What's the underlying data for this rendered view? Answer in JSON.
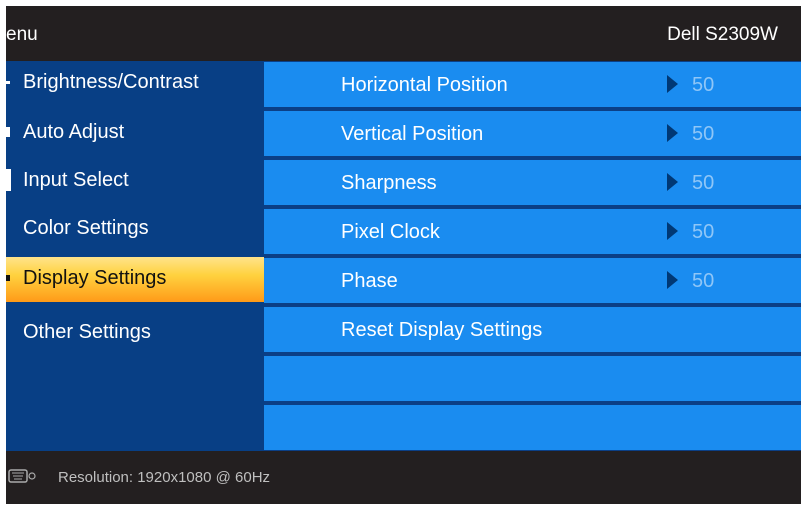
{
  "header": {
    "menu_title": "enu",
    "model": "Dell S2309W"
  },
  "sidebar": {
    "items": [
      {
        "label": "Brightness/Contrast"
      },
      {
        "label": "Auto Adjust"
      },
      {
        "label": "Input Select"
      },
      {
        "label": "Color Settings"
      },
      {
        "label": "Display Settings",
        "active": true
      },
      {
        "label": "Other Settings"
      }
    ]
  },
  "display_settings": {
    "rows": [
      {
        "label": "Horizontal Position",
        "value": "50"
      },
      {
        "label": "Vertical Position",
        "value": "50"
      },
      {
        "label": "Sharpness",
        "value": "50"
      },
      {
        "label": "Pixel Clock",
        "value": "50"
      },
      {
        "label": "Phase",
        "value": "50"
      },
      {
        "label": "Reset Display Settings"
      }
    ]
  },
  "footer": {
    "resolution": "Resolution: 1920x1080 @ 60Hz",
    "icon": "vga-connector-icon"
  },
  "colors": {
    "header_bg": "#231f20",
    "sidebar_bg": "#083f85",
    "row_bg": "#1a8cf0",
    "active_item": "#ffd23f",
    "value_text": "#8fc6f7"
  }
}
